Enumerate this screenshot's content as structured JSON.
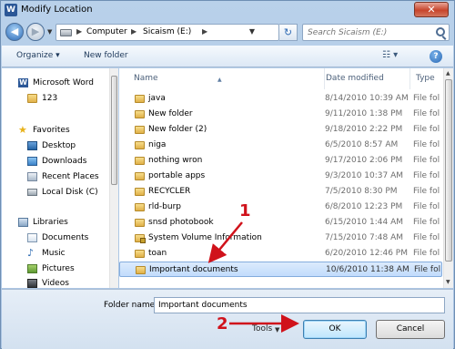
{
  "window": {
    "title": "Modify Location",
    "app_icon_letter": "W",
    "close_glyph": "✕"
  },
  "address": {
    "crumbs": [
      "Computer",
      "Sicaism (E:)"
    ],
    "search_placeholder": "Search Sicaism (E:)"
  },
  "commands": {
    "organize": "Organize ▾",
    "new_folder": "New folder"
  },
  "nav": {
    "items": [
      {
        "label": "Microsoft Word",
        "icon": "word-icon"
      },
      {
        "label": "123",
        "icon": "folder-icon"
      },
      {
        "label": "Favorites",
        "icon": "star-icon"
      },
      {
        "label": "Desktop",
        "icon": "desktop-icon"
      },
      {
        "label": "Downloads",
        "icon": "downloads-icon"
      },
      {
        "label": "Recent Places",
        "icon": "recent-places-icon"
      },
      {
        "label": "Local Disk (C)",
        "icon": "disk-icon"
      },
      {
        "label": "Libraries",
        "icon": "library-icon"
      },
      {
        "label": "Documents",
        "icon": "documents-icon"
      },
      {
        "label": "Music",
        "icon": "music-icon"
      },
      {
        "label": "Pictures",
        "icon": "pictures-icon"
      },
      {
        "label": "Videos",
        "icon": "videos-icon"
      }
    ]
  },
  "columns": {
    "name": "Name",
    "date": "Date modified",
    "type": "Type"
  },
  "files": [
    {
      "name": "java",
      "date": "8/14/2010 10:39 AM",
      "type": "File fol"
    },
    {
      "name": "New folder",
      "date": "9/11/2010 1:38 PM",
      "type": "File fol"
    },
    {
      "name": "New folder (2)",
      "date": "9/18/2010 2:22 PM",
      "type": "File fol"
    },
    {
      "name": "niga",
      "date": "6/5/2010 8:57 AM",
      "type": "File fol"
    },
    {
      "name": "nothing wron",
      "date": "9/17/2010 2:06 PM",
      "type": "File fol"
    },
    {
      "name": "portable apps",
      "date": "9/3/2010 10:37 AM",
      "type": "File fol"
    },
    {
      "name": "RECYCLER",
      "date": "7/5/2010 8:30 PM",
      "type": "File fol"
    },
    {
      "name": "rld-burp",
      "date": "6/8/2010 12:23 PM",
      "type": "File fol"
    },
    {
      "name": "snsd photobook",
      "date": "6/15/2010 1:44 AM",
      "type": "File fol"
    },
    {
      "name": "System Volume Information",
      "date": "7/15/2010 7:48 AM",
      "type": "File fol"
    },
    {
      "name": "toan",
      "date": "6/20/2010 12:46 PM",
      "type": "File fol"
    },
    {
      "name": "Important documents",
      "date": "10/6/2010 11:38 AM",
      "type": "File fol",
      "selected": true
    }
  ],
  "footer": {
    "folder_name_label": "Folder name:",
    "folder_name_value": "Important documents",
    "tools_label": "Tools",
    "ok_label": "OK",
    "cancel_label": "Cancel"
  },
  "annotations": {
    "step1": "1",
    "step2": "2",
    "color": "#d0121b"
  },
  "colors": {
    "selection": "#c1dcfc",
    "title_bar": "#b9d1ea"
  }
}
